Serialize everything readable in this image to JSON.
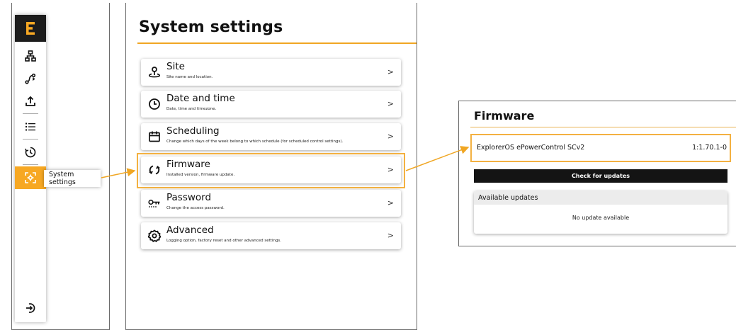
{
  "sidebar": {
    "logo_icon": "brand-e-logo",
    "items": [
      {
        "icon": "network-icon"
      },
      {
        "icon": "route-icon"
      },
      {
        "icon": "upload-icon"
      },
      {
        "icon": "list-icon"
      },
      {
        "icon": "timer-icon"
      },
      {
        "icon": "settings-scan-icon",
        "active": true
      }
    ],
    "bottom_icon": "logout-icon",
    "tooltip": "System settings"
  },
  "settings": {
    "title": "System settings",
    "items": [
      {
        "title": "Site",
        "subtitle": "Site name and location.",
        "icon": "location-pin-icon"
      },
      {
        "title": "Date and time",
        "subtitle": "Date, time and timezone.",
        "icon": "clock-icon"
      },
      {
        "title": "Scheduling",
        "subtitle": "Change which days of the week belong to which schedule (for scheduled control settings).",
        "icon": "calendar-icon"
      },
      {
        "title": "Firmware",
        "subtitle": "Installed version, firmware update.",
        "icon": "refresh-icon",
        "highlighted": true
      },
      {
        "title": "Password",
        "subtitle": "Change the access password.",
        "icon": "key-icon"
      },
      {
        "title": "Advanced",
        "subtitle": "Logging option, factory reset and other advanced settings.",
        "icon": "gear-icon"
      }
    ],
    "chevron": ">"
  },
  "firmware": {
    "title": "Firmware",
    "product": "ExplorerOS ePowerControl SCv2",
    "version": "1:1.70.1-0",
    "check_button": "Check for updates",
    "available_header": "Available updates",
    "available_message": "No update available"
  },
  "colors": {
    "accent": "#f7a823",
    "highlight": "#f3b141",
    "dark": "#141414"
  }
}
